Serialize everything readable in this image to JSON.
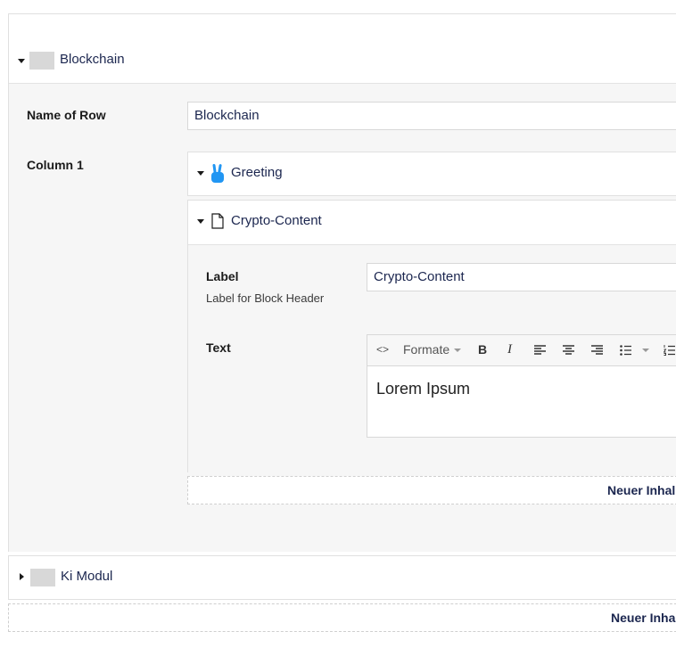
{
  "rows": [
    {
      "title": "Blockchain",
      "expanded": true
    },
    {
      "title": "Ki Modul",
      "expanded": false
    }
  ],
  "fields": {
    "name_label": "Name of Row",
    "name_value": "Blockchain",
    "column_label": "Column 1"
  },
  "blocks": [
    {
      "title": "Greeting",
      "icon": "peace-hand-icon"
    },
    {
      "title": "Crypto-Content",
      "icon": "document-icon"
    }
  ],
  "crypto": {
    "label_label": "Label",
    "label_help": "Label for Block Header",
    "label_value": "Crypto-Content",
    "text_label": "Text",
    "toolbar": {
      "code": "<>",
      "formats": "Formate",
      "bold": "B",
      "italic": "I"
    },
    "content": "Lorem Ipsum"
  },
  "add_content_label": "Neuer Inhal",
  "add_content_label_outer": "Neuer Inha",
  "colors": {
    "accent": "#2196f3",
    "text": "#1b264f"
  }
}
